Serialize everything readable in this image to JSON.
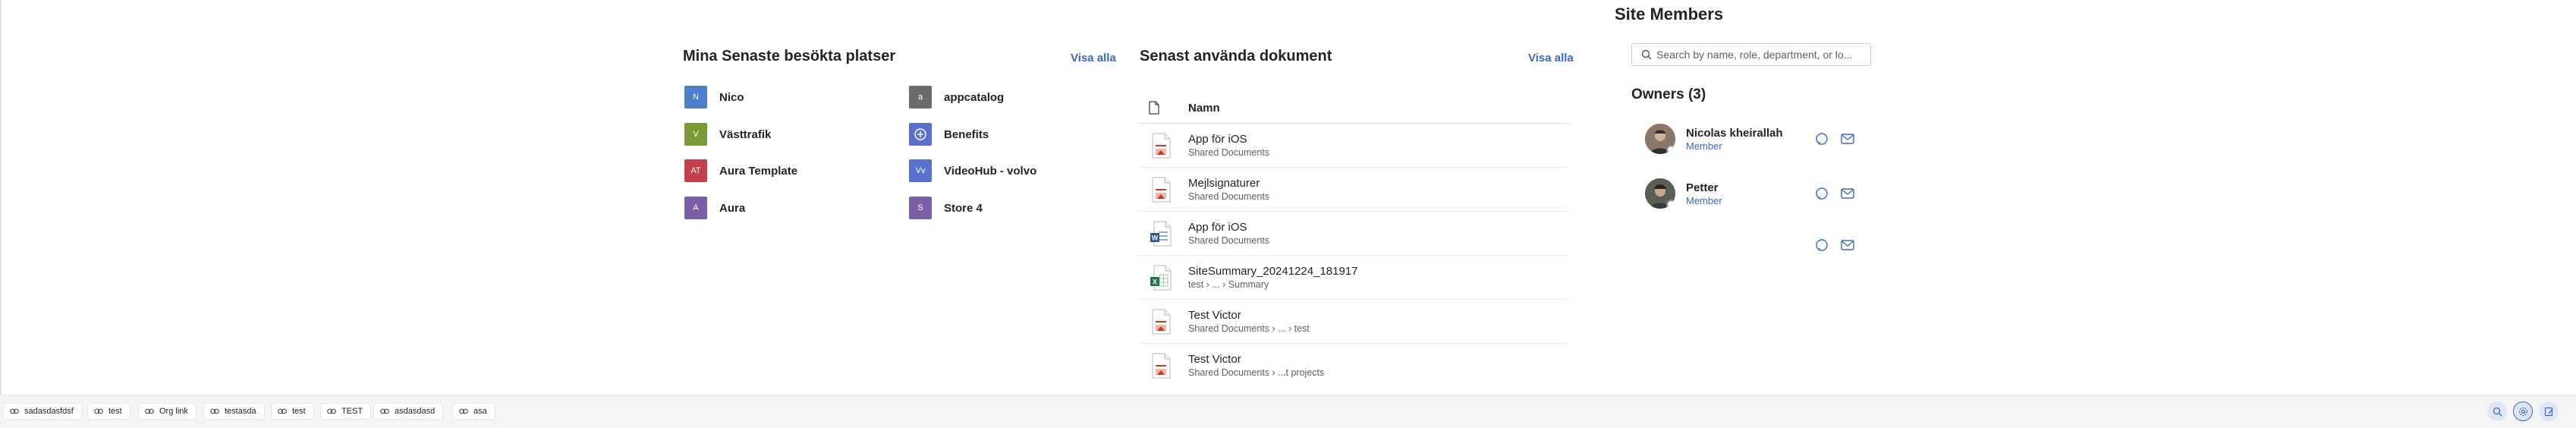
{
  "recent_places": {
    "title": "Mina Senaste besökta platser",
    "see_all": "Visa alla",
    "items": [
      {
        "label": "Nico",
        "initials": "N",
        "color": "#4e7fcf"
      },
      {
        "label": "Västtrafik",
        "initials": "V",
        "color": "#7a9a36"
      },
      {
        "label": "Aura Template",
        "initials": "AT",
        "color": "#c4404d"
      },
      {
        "label": "Aura",
        "initials": "A",
        "color": "#7a5fa8"
      },
      {
        "label": "appcatalog",
        "initials": "a",
        "color": "#6b6b6b"
      },
      {
        "label": "Benefits",
        "initials": "",
        "color": "#5a6fd0"
      },
      {
        "label": "VideoHub - volvo",
        "initials": "Vv",
        "color": "#5773cf"
      },
      {
        "label": "Store 4",
        "initials": "S",
        "color": "#7a5fa8"
      }
    ]
  },
  "recent_docs": {
    "title": "Senast använda dokument",
    "see_all": "Visa alla",
    "column_name": "Namn",
    "items": [
      {
        "title": "App för iOS",
        "path": "Shared Documents",
        "type": "ppt"
      },
      {
        "title": "Mejlsignaturer",
        "path": "Shared Documents",
        "type": "ppt"
      },
      {
        "title": "App för iOS",
        "path": "Shared Documents",
        "type": "word"
      },
      {
        "title": "SiteSummary_20241224_181917",
        "path": "test › ... › Summary",
        "type": "excel"
      },
      {
        "title": "Test Victor",
        "path": "Shared Documents › ... › test",
        "type": "ppt"
      },
      {
        "title": "Test Victor",
        "path": "Shared Documents › ...t projects",
        "type": "ppt"
      }
    ]
  },
  "site_members": {
    "title": "Site Members",
    "search_placeholder": "Search by name, role, department, or lo...",
    "owners_label": "Owners (3)",
    "members": [
      {
        "name": "Nicolas kheirallah",
        "role": "Member"
      },
      {
        "name": "Petter",
        "role": "Member"
      }
    ]
  },
  "footer": {
    "links": [
      "sadasdasfdsf",
      "test",
      "Org link",
      "testasda",
      "test",
      "TEST",
      "asdasdasd",
      "asa"
    ]
  },
  "colors": {
    "accent": "#3a69c7",
    "ppt": "#c43e1c",
    "word": "#2b579a",
    "excel": "#217346"
  }
}
